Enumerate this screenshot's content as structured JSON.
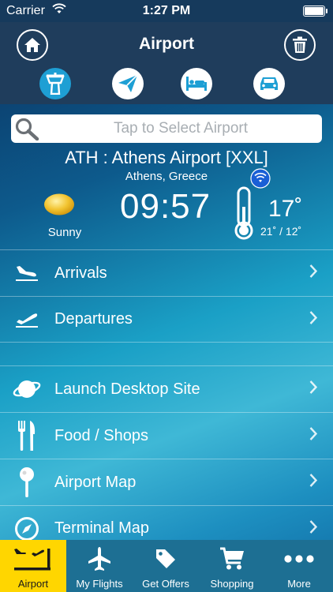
{
  "status_bar": {
    "carrier": "Carrier",
    "time": "1:27 PM"
  },
  "header": {
    "title": "Airport"
  },
  "categories": [
    {
      "name": "airport-tower",
      "icon": "control-tower-icon",
      "active": true
    },
    {
      "name": "flights",
      "icon": "paper-plane-icon",
      "active": false
    },
    {
      "name": "hotels",
      "icon": "bed-icon",
      "active": false
    },
    {
      "name": "cars",
      "icon": "car-icon",
      "active": false
    }
  ],
  "search": {
    "placeholder": "Tap to Select Airport"
  },
  "airport": {
    "name": "ATH : Athens Airport [XXL]",
    "city": "Athens, Greece"
  },
  "weather": {
    "condition": "Sunny",
    "local_time": "09:57",
    "temperature": "17˚",
    "range": "21˚ /  12˚"
  },
  "menu": {
    "group_a": [
      {
        "label": "Arrivals",
        "icon": "arrival-plane-icon"
      },
      {
        "label": "Departures",
        "icon": "departure-plane-icon"
      }
    ],
    "group_b": [
      {
        "label": "Launch Desktop Site",
        "icon": "planet-icon"
      },
      {
        "label": "Food / Shops",
        "icon": "fork-knife-icon"
      },
      {
        "label": "Airport Map",
        "icon": "map-pin-icon"
      },
      {
        "label": "Terminal Map",
        "icon": "compass-icon"
      }
    ]
  },
  "tabbar": {
    "airport": "Airport",
    "my_flights": "My Flights",
    "get_offers": "Get Offers",
    "shopping": "Shopping",
    "more": "More"
  },
  "colors": {
    "accent": "#1e9fd4",
    "active_tab": "#ffd600",
    "header": "#1f3d5c",
    "tabbar": "#1d6f93"
  }
}
